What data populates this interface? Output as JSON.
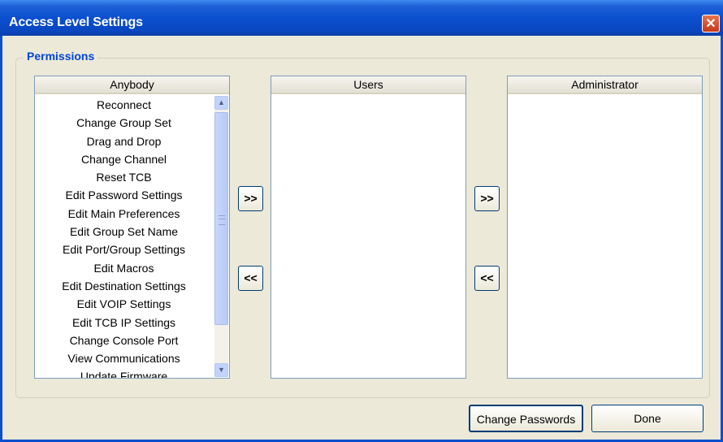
{
  "window": {
    "title": "Access Level Settings",
    "close_glyph": "✕"
  },
  "permissions": {
    "group_label": "Permissions",
    "anybody": {
      "header": "Anybody",
      "items": [
        "Reconnect",
        "Change Group Set",
        "Drag and Drop",
        "Change Channel",
        "Reset TCB",
        "Edit Password Settings",
        "Edit Main Preferences",
        "Edit Group Set Name",
        "Edit Port/Group Settings",
        "Edit Macros",
        "Edit Destination Settings",
        "Edit VOIP Settings",
        "Edit TCB IP Settings",
        "Change Console Port",
        "View Communications",
        "Update Firmware"
      ]
    },
    "users": {
      "header": "Users",
      "items": []
    },
    "administrator": {
      "header": "Administrator",
      "items": []
    },
    "move_right_label": ">>",
    "move_left_label": "<<"
  },
  "footer": {
    "change_passwords_label": "Change Passwords",
    "done_label": "Done"
  }
}
